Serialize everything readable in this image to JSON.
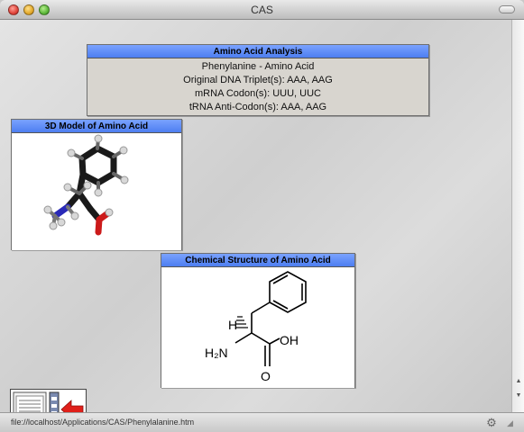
{
  "window": {
    "title": "CAS"
  },
  "analysis": {
    "header": "Amino Acid Analysis",
    "name_line": "Phenylanine - Amino Acid",
    "dna_line": "Original DNA Triplet(s): AAA, AAG",
    "mrna_line": "mRNA Codon(s): UUU, UUC",
    "trna_line": "tRNA Anti-Codon(s): AAA, AAG"
  },
  "model": {
    "header": "3D Model of Amino Acid"
  },
  "structure": {
    "header": "Chemical Structure of Amino Acid",
    "label_h": "H",
    "label_h2n": "H₂N",
    "label_oh": "OH",
    "label_o": "O"
  },
  "nav": {
    "doc_icon": "document-list-icon",
    "back_icon": "back-arrow-icon"
  },
  "status": {
    "url": "file://localhost/Applications/CAS/Phenylalanine.htm"
  },
  "colors": {
    "header_blue": "#4d7ef0",
    "back_arrow_red": "#e0201a"
  }
}
